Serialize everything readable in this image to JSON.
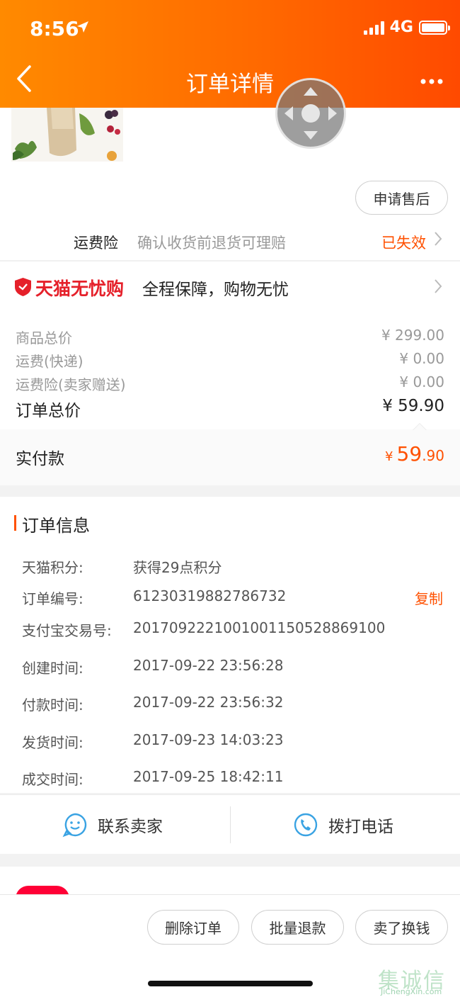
{
  "status_bar": {
    "time": "8:56",
    "network": "4G"
  },
  "header": {
    "title": "订单详情"
  },
  "product": {
    "aftersale_label": "申请售后"
  },
  "shipping_insurance": {
    "title": "运费险",
    "desc": "确认收货前退货可理赔",
    "status": "已失效"
  },
  "guarantee": {
    "brand": "天猫无忧购",
    "slogan": "全程保障，购物无忧"
  },
  "prices": {
    "items": [
      {
        "label": "商品总价",
        "value": "¥ 299.00"
      },
      {
        "label": "运费(快递)",
        "value": "¥ 0.00"
      },
      {
        "label": "运费险(卖家赠送)",
        "value": "¥ 0.00"
      }
    ],
    "total_label": "订单总价",
    "total_value": "¥ 59.90",
    "paid_label": "实付款",
    "paid_currency": "¥",
    "paid_int": "59",
    "paid_dec": ".90"
  },
  "order_info": {
    "title": "订单信息",
    "rows": [
      {
        "label": "天猫积分:",
        "value": "获得29点积分"
      },
      {
        "label": "订单编号:",
        "value": "61230319882786732"
      },
      {
        "label": "支付宝交易号:",
        "value": "2017092221001001150528869100"
      },
      {
        "label": "创建时间:",
        "value": "2017-09-22 23:56:28"
      },
      {
        "label": "付款时间:",
        "value": "2017-09-22 23:56:32"
      },
      {
        "label": "发货时间:",
        "value": "2017-09-23 14:03:23"
      },
      {
        "label": "成交时间:",
        "value": "2017-09-25 18:42:11"
      }
    ],
    "copy_label": "复制"
  },
  "contact": {
    "seller_label": "联系卖家",
    "phone_label": "拨打电话"
  },
  "bottom_bar": {
    "delete_label": "删除订单",
    "refund_label": "批量退款",
    "resell_label": "卖了换钱"
  },
  "watermark": {
    "han": "集诚信",
    "url": "JiChengXin.com"
  },
  "colors": {
    "accent": "#ff5000",
    "header": "#ff6a00",
    "tmall_red": "#e5202a"
  }
}
